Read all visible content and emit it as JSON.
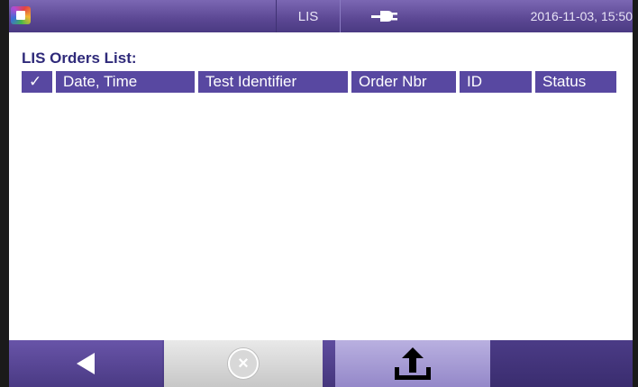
{
  "topbar": {
    "title": "LIS",
    "status_icon": "plug-icon",
    "datetime": "2016-11-03, 15:50"
  },
  "orders": {
    "heading": "LIS Orders List:",
    "columns": [
      "✓",
      "Date, Time",
      "Test Identifier",
      "Order Nbr",
      "ID",
      "Status"
    ],
    "rows": []
  },
  "toolbar": {
    "back_icon": "back-arrow-icon",
    "cancel_icon": "cancel-icon",
    "export_icon": "upload-icon"
  },
  "colors": {
    "bar": "#5848a1",
    "heading_text": "#2f2a7a"
  }
}
